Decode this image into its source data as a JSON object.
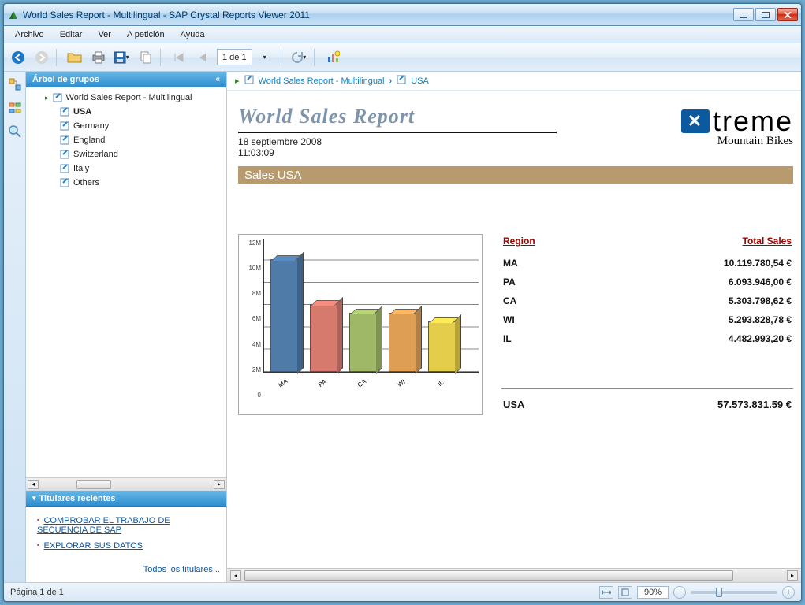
{
  "window": {
    "title": "World Sales Report - Multilingual - SAP Crystal Reports Viewer 2011"
  },
  "menu": [
    "Archivo",
    "Editar",
    "Ver",
    "A petición",
    "Ayuda"
  ],
  "toolbar": {
    "page_indicator": "1 de 1"
  },
  "side": {
    "group_tree_title": "Árbol de grupos",
    "tree_root": "World Sales Report - Multilingual",
    "tree_items": [
      "USA",
      "Germany",
      "England",
      "Switzerland",
      "Italy",
      "Others"
    ],
    "headlines_title": "Titulares recientes",
    "headline_links": [
      "COMPROBAR EL TRABAJO DE SECUENCIA DE SAP",
      "EXPLORAR SUS DATOS"
    ],
    "all_headlines": "Todos los titulares..."
  },
  "breadcrumb": {
    "a": "World Sales Report - Multilingual",
    "b": "USA"
  },
  "report": {
    "title": "World Sales Report",
    "date": "18 septiembre 2008",
    "time": "11:03:09",
    "logo_brand": "treme",
    "logo_sub": "Mountain Bikes",
    "section_label": "Sales USA",
    "table_headers": {
      "region": "Region",
      "total": "Total Sales"
    },
    "rows": [
      {
        "region": "MA",
        "total": "10.119.780,54 €"
      },
      {
        "region": "PA",
        "total": "6.093.946,00 €"
      },
      {
        "region": "CA",
        "total": "5.303.798,62 €"
      },
      {
        "region": "WI",
        "total": "5.293.828,78 €"
      },
      {
        "region": "IL",
        "total": "4.482.993,20 €"
      }
    ],
    "total_row": {
      "region": "USA",
      "total": "57.573.831.59 €"
    }
  },
  "chart_data": {
    "type": "bar",
    "categories": [
      "MA",
      "PA",
      "CA",
      "WI",
      "IL"
    ],
    "values": [
      10.1,
      6.1,
      5.3,
      5.3,
      4.5
    ],
    "yticks": [
      "12M",
      "10M",
      "8M",
      "6M",
      "4M",
      "2M",
      "0"
    ],
    "ylim": [
      0,
      12
    ],
    "colors": [
      "#4e7ba8",
      "#d77a6e",
      "#9fb867",
      "#de9f55",
      "#e4cd4a"
    ]
  },
  "status": {
    "page_label": "Página 1 de 1",
    "zoom_value": "90%"
  }
}
